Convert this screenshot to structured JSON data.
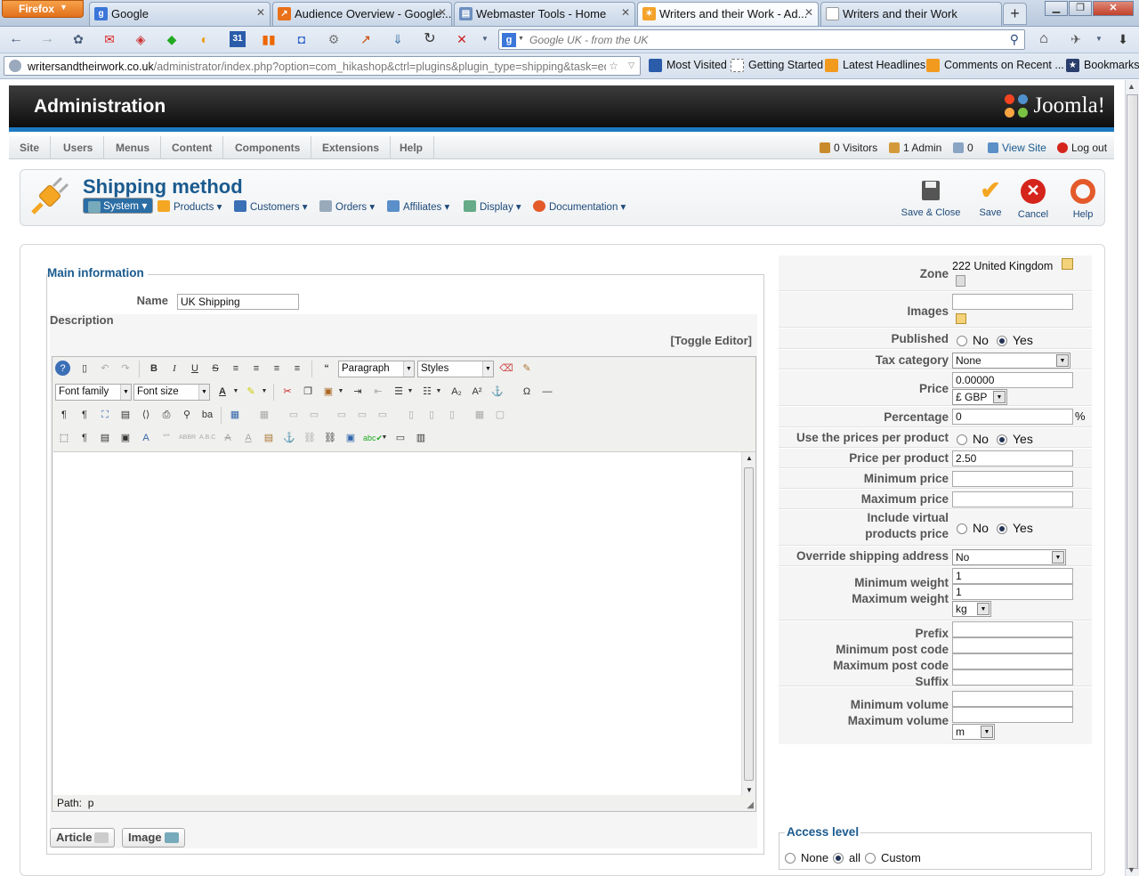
{
  "browser": {
    "menu_button": "Firefox",
    "tabs": [
      {
        "title": "Google",
        "icon_color": "#3b76d9",
        "icon": "g-icon",
        "active": false
      },
      {
        "title": "Audience Overview - Google...",
        "icon_color": "#e8711a",
        "icon": "analytics-icon",
        "active": false
      },
      {
        "title": "Webmaster Tools - Home",
        "icon_color": "#6b8fbf",
        "icon": "webmaster-icon",
        "active": false
      },
      {
        "title": "Writers and their Work - Ad...",
        "icon_color": "#f4a22a",
        "icon": "joomla-icon",
        "active": true
      },
      {
        "title": "Writers and their Work",
        "icon_color": "#ffffff",
        "icon": "blank-page-icon",
        "active": false
      }
    ],
    "new_tab": "+",
    "search_placeholder": "Google UK - from the UK",
    "url_domain": "writersandtheirwork.co.uk",
    "url_path": "/administrator/index.php?option=com_hikashop&ctrl=plugins&plugin_type=shipping&task=ed",
    "bookmarks": [
      "Most Visited",
      "Getting Started",
      "Latest Headlines",
      "Comments on Recent ...",
      "Bookmarks"
    ]
  },
  "admin": {
    "title": "Administration",
    "logo_text": "Joomla!",
    "menu": [
      "Site",
      "Users",
      "Menus",
      "Content",
      "Components",
      "Extensions",
      "Help"
    ],
    "status": {
      "visitors": "0 Visitors",
      "admins": "1 Admin",
      "messages": "0",
      "view_site": "View Site",
      "logout": "Log out"
    }
  },
  "toolbar": {
    "page_title": "Shipping method",
    "hika_menu": [
      "System",
      "Products",
      "Customers",
      "Orders",
      "Affiliates",
      "Display",
      "Documentation"
    ],
    "buttons": {
      "save_close": "Save & Close",
      "save": "Save",
      "cancel": "Cancel",
      "help": "Help"
    }
  },
  "main_info": {
    "legend": "Main information",
    "name_label": "Name",
    "name_value": "UK Shipping",
    "description_label": "Description",
    "toggle_editor": "[Toggle Editor]",
    "editor": {
      "format_select": "Paragraph",
      "styles_select": "Styles",
      "font_family": "Font family",
      "font_size": "Font size",
      "path_label": "Path:",
      "path_value": "p"
    },
    "article_button": "Article",
    "image_button": "Image"
  },
  "settings": {
    "zone_label": "Zone",
    "zone_value": "222 United Kingdom",
    "images_label": "Images",
    "images_value": "",
    "published_label": "Published",
    "no": "No",
    "yes": "Yes",
    "published": "Yes",
    "tax_label": "Tax category",
    "tax_value": "None",
    "price_label": "Price",
    "price_value": "0.00000",
    "currency": "£ GBP",
    "percentage_label": "Percentage",
    "percentage_value": "0",
    "percent_sign": "%",
    "use_prices_label": "Use the prices per product",
    "use_prices": "Yes",
    "price_per_product_label": "Price per product",
    "price_per_product_value": "2.50",
    "min_price_label": "Minimum price",
    "max_price_label": "Maximum price",
    "include_virtual_label_1": "Include virtual",
    "include_virtual_label_2": "products price",
    "include_virtual": "Yes",
    "override_label": "Override shipping address",
    "override_value": "No",
    "min_weight_label": "Minimum weight",
    "min_weight_value": "1",
    "max_weight_label": "Maximum weight",
    "max_weight_value": "1",
    "weight_unit": "kg",
    "prefix_label": "Prefix",
    "min_post_label": "Minimum post code",
    "max_post_label": "Maximum post code",
    "suffix_label": "Suffix",
    "min_volume_label": "Minimum volume",
    "max_volume_label": "Maximum volume",
    "volume_unit": "m",
    "access_legend": "Access level",
    "access_none": "None",
    "access_all": "all",
    "access_custom": "Custom",
    "access_selected": "all"
  }
}
